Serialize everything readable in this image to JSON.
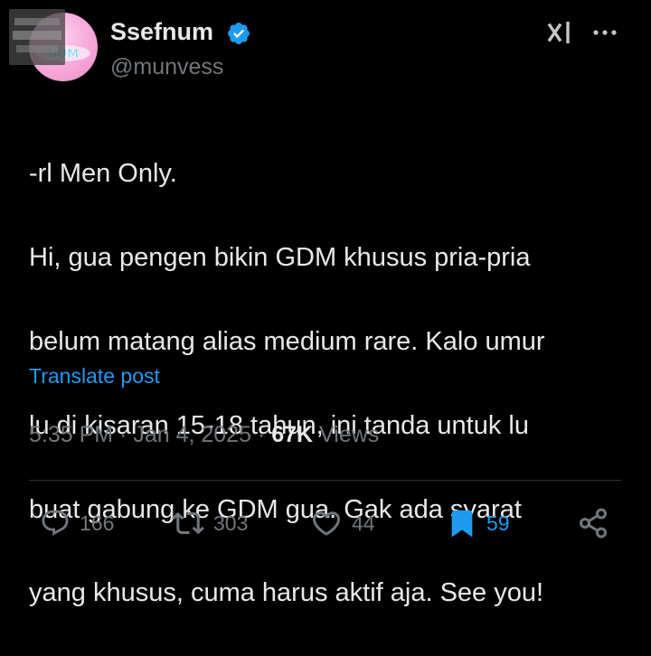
{
  "author": {
    "display_name": "Ssefnum",
    "handle": "@munvess",
    "verified": true,
    "avatar_logo_text": "NUM"
  },
  "tweet": {
    "lines": [
      "-rl Men Only.",
      "Hi, gua pengen bikin GDM khusus pria-pria",
      "belum matang alias medium rare. Kalo umur",
      "lu di kisaran 15-18 tahun, ini tanda untuk lu",
      "buat gabung ke GDM gua. Gak ada syarat",
      "yang khusus, cuma harus aktif aja. See you!"
    ],
    "translate_label": "Translate post"
  },
  "meta": {
    "time": "5:35 PM",
    "separator": " · ",
    "date": "Jan 4, 2025",
    "views_count": "67K",
    "views_label": "Views"
  },
  "actions": {
    "replies": "166",
    "reposts": "303",
    "likes": "44",
    "bookmarks": "59"
  },
  "colors": {
    "background": "#000000",
    "text": "#e7e9ea",
    "secondary": "#71767b",
    "accent": "#1d9bf0",
    "divider": "#2f3336"
  },
  "icons": [
    "verified-badge-icon",
    "grok-icon",
    "more-icon",
    "reply-icon",
    "repost-icon",
    "like-icon",
    "bookmark-icon",
    "share-icon"
  ]
}
